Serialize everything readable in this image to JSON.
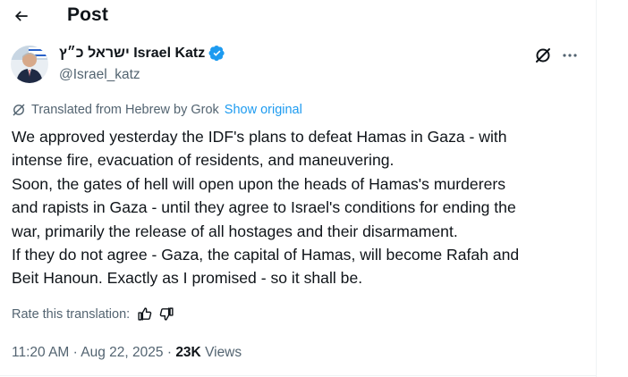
{
  "header": {
    "title": "Post"
  },
  "author": {
    "display_name": "ישראל כ״ץ Israel Katz",
    "handle": "@Israel_katz"
  },
  "translation": {
    "label": "Translated from Hebrew by Grok",
    "show_original": "Show original"
  },
  "post": {
    "lines": [
      "We approved yesterday the IDF's plans to defeat Hamas in Gaza - with",
      "intense fire, evacuation of residents, and maneuvering.",
      "Soon, the gates of hell will open upon the heads of Hamas's murderers",
      "and rapists in Gaza - until they agree to Israel's conditions for ending the",
      "war, primarily the release of all hostages and their disarmament.",
      "If they do not agree - Gaza, the capital of Hamas, will become Rafah and",
      "Beit Hanoun. Exactly as I promised - so it shall be."
    ]
  },
  "rating": {
    "label": "Rate this translation:"
  },
  "meta": {
    "time": "11:20 AM",
    "separator": "·",
    "date": "Aug 22, 2025",
    "views_count": "23K",
    "views_label": "Views"
  },
  "colors": {
    "text_primary": "#0f1419",
    "text_secondary": "#536471",
    "accent_blue": "#1d9bf0",
    "border": "#eff3f4"
  },
  "icons": {
    "back": "arrow-left-icon",
    "verified": "verified-badge-icon",
    "grok": "grok-icon",
    "more": "more-horizontal-icon",
    "translate": "grok-translate-icon",
    "like": "thumbs-up-icon",
    "dislike": "thumbs-down-icon"
  }
}
